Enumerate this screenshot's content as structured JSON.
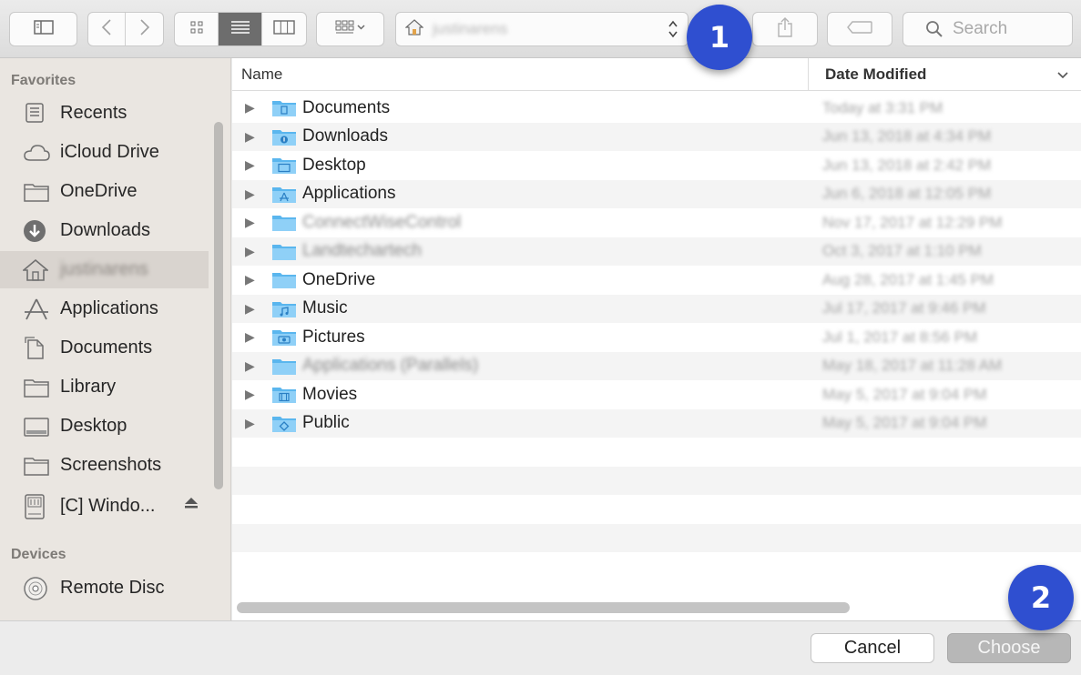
{
  "toolbar": {
    "path_location": "justinarens",
    "search_placeholder": "Search",
    "view_mode": "list"
  },
  "badges": [
    "1",
    "2"
  ],
  "sidebar": {
    "favorites_header": "Favorites",
    "devices_header": "Devices",
    "favorites": [
      {
        "label": "Recents",
        "icon": "recents-icon"
      },
      {
        "label": "iCloud Drive",
        "icon": "cloud-icon"
      },
      {
        "label": "OneDrive",
        "icon": "folder-icon"
      },
      {
        "label": "Downloads",
        "icon": "download-icon"
      },
      {
        "label": "justinarens",
        "icon": "home-icon",
        "selected": true
      },
      {
        "label": "Applications",
        "icon": "applications-icon"
      },
      {
        "label": "Documents",
        "icon": "documents-icon"
      },
      {
        "label": "Library",
        "icon": "folder-icon"
      },
      {
        "label": "Desktop",
        "icon": "desktop-icon"
      },
      {
        "label": "Screenshots",
        "icon": "folder-icon"
      },
      {
        "label": "[C] Windo...",
        "icon": "drive-icon",
        "eject": true
      }
    ],
    "devices": [
      {
        "label": "Remote Disc",
        "icon": "disc-icon"
      }
    ]
  },
  "list": {
    "col_name": "Name",
    "col_date": "Date Modified",
    "rows": [
      {
        "name": "Documents",
        "date": "Today at 3:31 PM",
        "icon": "documents-folder-icon"
      },
      {
        "name": "Downloads",
        "date": "Jun 13, 2018 at 4:34 PM",
        "icon": "downloads-folder-icon"
      },
      {
        "name": "Desktop",
        "date": "Jun 13, 2018 at 2:42 PM",
        "icon": "desktop-folder-icon"
      },
      {
        "name": "Applications",
        "date": "Jun 6, 2018 at 12:05 PM",
        "icon": "applications-folder-icon"
      },
      {
        "name": "ConnectWiseControl",
        "date": "Nov 17, 2017 at 12:29 PM",
        "icon": "folder-icon",
        "blurred": true
      },
      {
        "name": "Landtechartech",
        "date": "Oct 3, 2017 at 1:10 PM",
        "icon": "folder-icon",
        "blurred": true
      },
      {
        "name": "OneDrive",
        "date": "Aug 28, 2017 at 1:45 PM",
        "icon": "folder-icon"
      },
      {
        "name": "Music",
        "date": "Jul 17, 2017 at 9:46 PM",
        "icon": "music-folder-icon"
      },
      {
        "name": "Pictures",
        "date": "Jul 1, 2017 at 8:56 PM",
        "icon": "pictures-folder-icon"
      },
      {
        "name": "Applications (Parallels)",
        "date": "May 18, 2017 at 11:28 AM",
        "icon": "folder-icon",
        "blurred": true
      },
      {
        "name": "Movies",
        "date": "May 5, 2017 at 9:04 PM",
        "icon": "movies-folder-icon"
      },
      {
        "name": "Public",
        "date": "May 5, 2017 at 9:04 PM",
        "icon": "public-folder-icon"
      }
    ]
  },
  "buttons": {
    "cancel": "Cancel",
    "choose": "Choose"
  },
  "colors": {
    "folder_blue": "#5ab6ee",
    "badge_blue": "#2f4fd0",
    "selected_sidebar": "#d9d4cf"
  }
}
